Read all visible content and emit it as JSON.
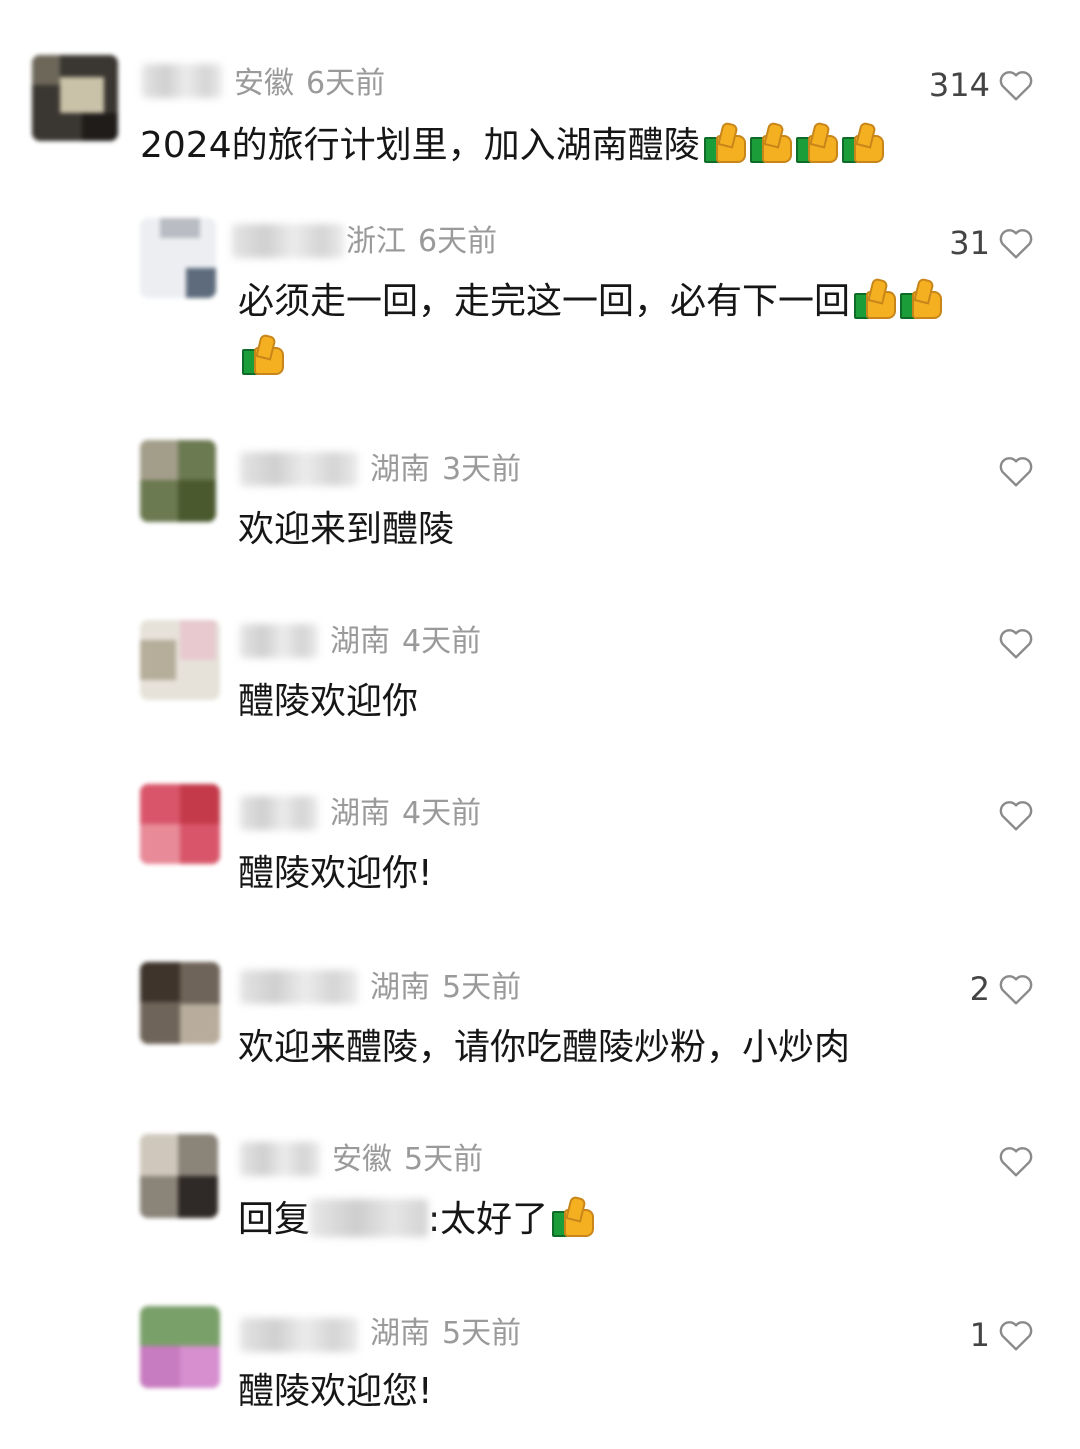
{
  "comments": [
    {
      "location": "安徽",
      "time": "6天前",
      "likes": "314",
      "text": "2024的旅行计划里，加入湖南醴陵",
      "emoji_count": 4
    },
    {
      "location": "浙江",
      "time": "6天前",
      "likes": "31",
      "text_line1": "必须走一回，走完这一回，必有下一回",
      "emoji_count": 3
    },
    {
      "location": "湖南",
      "time": "3天前",
      "likes": "",
      "text": "欢迎来到醴陵"
    },
    {
      "location": "湖南",
      "time": "4天前",
      "likes": "",
      "text": "醴陵欢迎你"
    },
    {
      "location": "湖南",
      "time": "4天前",
      "likes": "",
      "text": "醴陵欢迎你!"
    },
    {
      "location": "湖南",
      "time": "5天前",
      "likes": "2",
      "text": "欢迎来醴陵，请你吃醴陵炒粉，小炒肉"
    },
    {
      "location": "安徽",
      "time": "5天前",
      "likes": "",
      "reply_prefix": "回复",
      "reply_text": ":太好了",
      "emoji_count": 1
    },
    {
      "location": "湖南",
      "time": "5天前",
      "likes": "1",
      "text": "醴陵欢迎您!"
    }
  ],
  "icons": {
    "like": "heart-outline-icon",
    "emoji": "thumbs-up-emoji"
  },
  "colors": {
    "meta": "#9a9a9a",
    "text": "#161616",
    "heart": "#888888"
  }
}
